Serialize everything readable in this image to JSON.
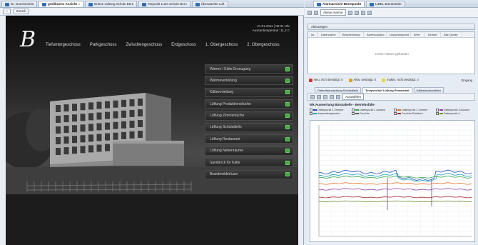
{
  "left": {
    "tabs": [
      {
        "label": "Dr. Durchschnitt",
        "active": false
      },
      {
        "label": "großbuchs Ansicht",
        "active": true
      },
      {
        "label": "Bühne Lüftung Schule Bern",
        "active": false
      },
      {
        "label": "Tarpunkt LUDI Schule Bern",
        "active": false
      },
      {
        "label": "Überwachte Luft",
        "active": false
      }
    ],
    "toolbar": {
      "button": "Zurück"
    },
    "viewer": {
      "logo": "B",
      "datetime": [
        "21.01.2011 | 09:31 Uhr",
        "Aussentemperatur: 11,2 C"
      ],
      "floors": [
        "Tiefuntergeschoss",
        "Parkgeschoss",
        "Zwischengeschoss",
        "Erdgeschoss",
        "1. Obergeschoss",
        "2. Obergeschoss"
      ],
      "menu": [
        "Wärme / Kälte Erzeugung",
        "Wärmeverteilung",
        "Kälteverteilung",
        "Lüftung Produktionsküche",
        "Lüftung Zimmerküche",
        "Lüftung Schulsäle/is",
        "Lüftung Restaurant",
        "Lüftung Nebenräume",
        "Sanitär/ch für Kälte",
        "Brandmelder/user"
      ]
    }
  },
  "right": {
    "tabs": [
      {
        "label": "Alarmansicht Bürotpunkt",
        "active": true
      },
      {
        "label": "LIBEL Bürobetrieb",
        "active": false
      }
    ],
    "toolbar": {
      "select": "Aktive Alarme"
    },
    "alarm_panel_title": "Aktivzeigen",
    "grid_columns": [
      "Nr.",
      "Datenname",
      "Beschreibung",
      "Alarmzustand",
      "Ursachenpunkt",
      "Wert",
      "Einheit",
      "Alte Quelle"
    ],
    "grid_empty": "Keine Alarme gefunden",
    "status": [
      {
        "text": "Neu, nicht bestätigt: 0",
        "color": "#d9342b"
      },
      {
        "text": "Aktiv, bestätigt: 0",
        "color": "#e4a21a"
      },
      {
        "text": "Inaktiv, nicht bestätigt: 0",
        "color": "#e8d63a"
      }
    ],
    "status_right": "Eingang",
    "chart_tabs": [
      {
        "label": "Datenüberwachung Schulsäle/is",
        "active": false
      },
      {
        "label": "Tempverlauf Lüftung Restaurant",
        "active": true
      },
      {
        "label": "Kältestundenzähler",
        "active": false
      }
    ],
    "chart_toolbar": {
      "select": "Auswählen"
    },
    "chart_title": "Wk Auswertung Bürotabelle - Betriebsfälle",
    "legend": [
      {
        "label": "Datenpunkt 1 Zimmer",
        "color": "#1f4fb6"
      },
      {
        "label": "Datenpunkt 1 Aussen",
        "color": "#33a34b"
      },
      {
        "label": "Datenpunkt 2 Zimmer",
        "color": "#e06a1a"
      },
      {
        "label": "Datenpunkt 3 Aussen",
        "color": "#8b3aa8"
      },
      {
        "label": "Aussentemperatur",
        "color": "#1aa6b6"
      },
      {
        "label": "Feuchte",
        "color": "#555555"
      },
      {
        "label": "Feuchte Rücklauf",
        "color": "#a32a2a"
      },
      {
        "label": "Datenpunkt 4",
        "color": "#6b8e23"
      }
    ]
  }
}
